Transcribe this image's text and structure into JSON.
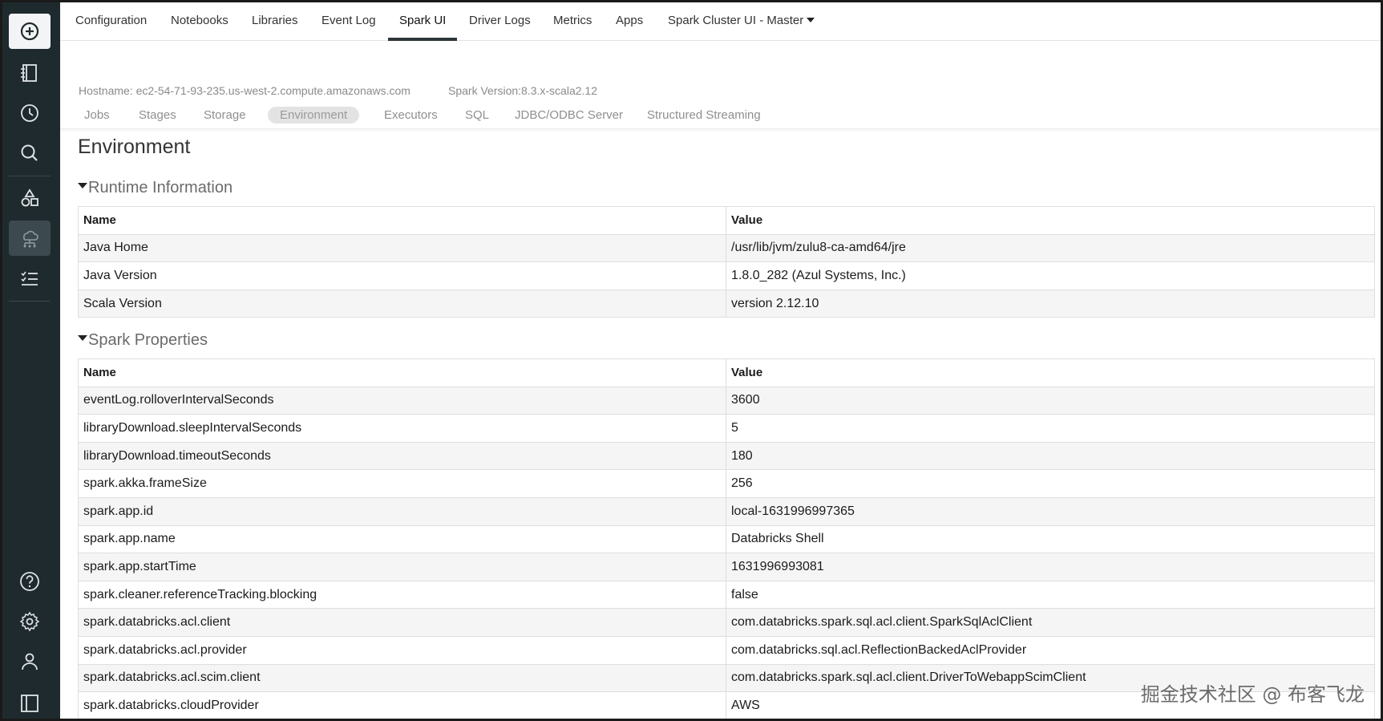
{
  "top_tabs": [
    {
      "label": "Configuration"
    },
    {
      "label": "Notebooks"
    },
    {
      "label": "Libraries"
    },
    {
      "label": "Event Log"
    },
    {
      "label": "Spark UI",
      "active": true
    },
    {
      "label": "Driver Logs"
    },
    {
      "label": "Metrics"
    },
    {
      "label": "Apps"
    },
    {
      "label": "Spark Cluster UI - Master"
    }
  ],
  "hostname": "Hostname: ec2-54-71-93-235.us-west-2.compute.amazonaws.com",
  "spark_version": "Spark Version:8.3.x-scala2.12",
  "sub_tabs": [
    {
      "label": "Jobs"
    },
    {
      "label": "Stages"
    },
    {
      "label": "Storage"
    },
    {
      "label": "Environment",
      "active": true
    },
    {
      "label": "Executors"
    },
    {
      "label": "SQL"
    },
    {
      "label": "JDBC/ODBC Server"
    },
    {
      "label": "Structured Streaming"
    }
  ],
  "page_title": "Environment",
  "runtime": {
    "heading": "Runtime Information",
    "headers": {
      "name": "Name",
      "value": "Value"
    },
    "rows": [
      {
        "name": "Java Home",
        "value": "/usr/lib/jvm/zulu8-ca-amd64/jre"
      },
      {
        "name": "Java Version",
        "value": "1.8.0_282 (Azul Systems, Inc.)"
      },
      {
        "name": "Scala Version",
        "value": "version 2.12.10"
      }
    ]
  },
  "spark_props": {
    "heading": "Spark Properties",
    "headers": {
      "name": "Name",
      "value": "Value"
    },
    "rows": [
      {
        "name": "eventLog.rolloverIntervalSeconds",
        "value": "3600"
      },
      {
        "name": "libraryDownload.sleepIntervalSeconds",
        "value": "5"
      },
      {
        "name": "libraryDownload.timeoutSeconds",
        "value": "180"
      },
      {
        "name": "spark.akka.frameSize",
        "value": "256"
      },
      {
        "name": "spark.app.id",
        "value": "local-1631996997365"
      },
      {
        "name": "spark.app.name",
        "value": "Databricks Shell"
      },
      {
        "name": "spark.app.startTime",
        "value": "1631996993081"
      },
      {
        "name": "spark.cleaner.referenceTracking.blocking",
        "value": "false"
      },
      {
        "name": "spark.databricks.acl.client",
        "value": "com.databricks.spark.sql.acl.client.SparkSqlAclClient"
      },
      {
        "name": "spark.databricks.acl.provider",
        "value": "com.databricks.sql.acl.ReflectionBackedAclProvider"
      },
      {
        "name": "spark.databricks.acl.scim.client",
        "value": "com.databricks.spark.sql.acl.client.DriverToWebappScimClient"
      },
      {
        "name": "spark.databricks.cloudProvider",
        "value": "AWS"
      }
    ]
  },
  "watermark": "掘金技术社区 @ 布客飞龙",
  "sidebar_icons": [
    "plus-circle-icon",
    "notebook-icon",
    "clock-icon",
    "search-icon",
    "shapes-icon",
    "cluster-icon",
    "checklist-icon",
    "help-icon",
    "gear-icon",
    "user-icon",
    "panel-icon"
  ]
}
